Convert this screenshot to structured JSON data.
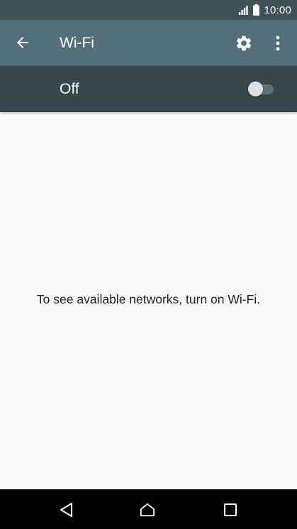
{
  "status_bar": {
    "time": "10:00",
    "icons": [
      "signal-icon",
      "battery-icon"
    ]
  },
  "app_bar": {
    "title": "Wi-Fi",
    "back_icon": "arrow-left-icon",
    "settings_icon": "gear-icon",
    "more_icon": "more-vertical-icon"
  },
  "wifi_switch": {
    "label": "Off",
    "state": "off"
  },
  "content": {
    "message": "To see available networks, turn on Wi-Fi."
  },
  "nav_bar": {
    "icons": [
      "nav-back-icon",
      "nav-home-icon",
      "nav-recents-icon"
    ]
  },
  "colors": {
    "status_bar": "#3f5159",
    "app_bar": "#546e7a",
    "switch_bar": "#37474f",
    "background": "#fafafa",
    "nav_bar": "#000000"
  }
}
